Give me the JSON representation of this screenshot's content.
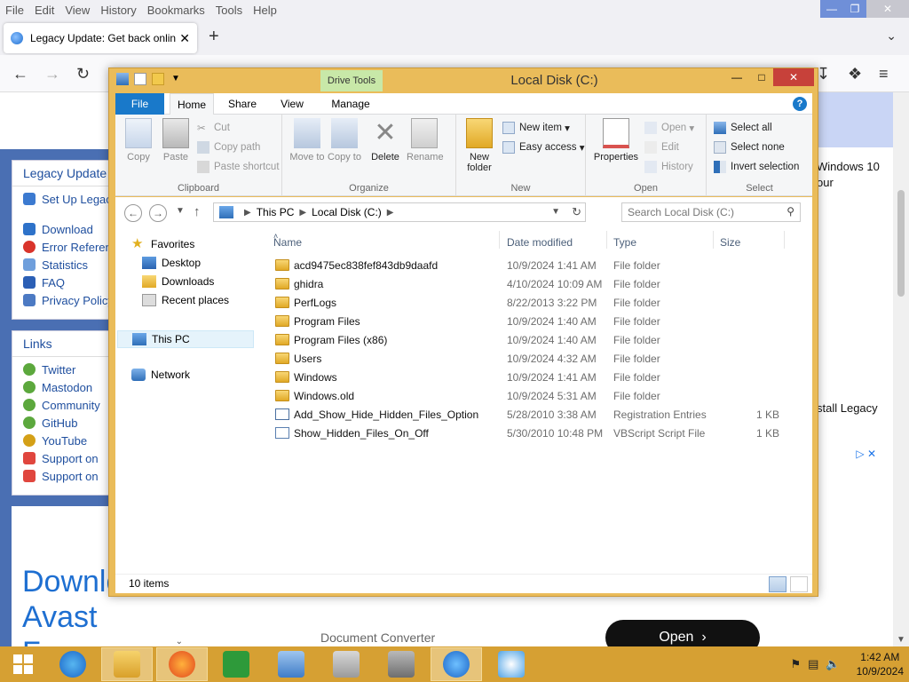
{
  "firefox": {
    "menu": [
      "File",
      "Edit",
      "View",
      "History",
      "Bookmarks",
      "Tools",
      "Help"
    ],
    "tab_title": "Legacy Update: Get back online",
    "sidebar_heading": "Legacy Update",
    "sidebar_items": [
      "Set Up Legacy Update",
      "Download",
      "Error Reference",
      "Statistics",
      "FAQ",
      "Privacy Policy"
    ],
    "links_heading": "Links",
    "links_items": [
      "Twitter",
      "Mastodon",
      "Community",
      "GitHub",
      "YouTube",
      "Support on",
      "Support on"
    ],
    "promo_line1": "Download",
    "promo_line2": "Avast",
    "promo_line3": "F",
    "main_text_1": "Windows 10",
    "main_text_2": "our",
    "main_text_3": "stall Legacy",
    "ad_doc_converter": "Document Converter",
    "ad_open_label": "Open"
  },
  "explorer": {
    "title": "Local Disk (C:)",
    "drive_tools_label": "Drive Tools",
    "tabs": {
      "file": "File",
      "home": "Home",
      "share": "Share",
      "view": "View",
      "manage": "Manage"
    },
    "ribbon": {
      "clipboard": {
        "label": "Clipboard",
        "copy": "Copy",
        "paste": "Paste",
        "cut": "Cut",
        "copy_path": "Copy path",
        "paste_shortcut": "Paste shortcut"
      },
      "organize": {
        "label": "Organize",
        "move_to": "Move to",
        "copy_to": "Copy to",
        "delete": "Delete",
        "rename": "Rename"
      },
      "new": {
        "label": "New",
        "new_folder": "New folder",
        "new_item": "New item",
        "easy_access": "Easy access"
      },
      "open": {
        "label": "Open",
        "properties": "Properties",
        "open": "Open",
        "edit": "Edit",
        "history": "History"
      },
      "select": {
        "label": "Select",
        "select_all": "Select all",
        "select_none": "Select none",
        "invert_selection": "Invert selection"
      }
    },
    "address": {
      "crumbs": [
        "This PC",
        "Local Disk (C:)"
      ],
      "search_placeholder": "Search Local Disk (C:)"
    },
    "nav_pane": {
      "favorites": "Favorites",
      "desktop": "Desktop",
      "downloads": "Downloads",
      "recent_places": "Recent places",
      "this_pc": "This PC",
      "network": "Network"
    },
    "columns": {
      "name": "Name",
      "date_modified": "Date modified",
      "type": "Type",
      "size": "Size"
    },
    "files": [
      {
        "name": "acd9475ec838fef843db9daafd",
        "date": "10/9/2024 1:41 AM",
        "type": "File folder",
        "size": "",
        "kind": "folder"
      },
      {
        "name": "ghidra",
        "date": "4/10/2024 10:09 AM",
        "type": "File folder",
        "size": "",
        "kind": "folder"
      },
      {
        "name": "PerfLogs",
        "date": "8/22/2013 3:22 PM",
        "type": "File folder",
        "size": "",
        "kind": "folder"
      },
      {
        "name": "Program Files",
        "date": "10/9/2024 1:40 AM",
        "type": "File folder",
        "size": "",
        "kind": "folder"
      },
      {
        "name": "Program Files (x86)",
        "date": "10/9/2024 1:40 AM",
        "type": "File folder",
        "size": "",
        "kind": "folder"
      },
      {
        "name": "Users",
        "date": "10/9/2024 4:32 AM",
        "type": "File folder",
        "size": "",
        "kind": "folder"
      },
      {
        "name": "Windows",
        "date": "10/9/2024 1:41 AM",
        "type": "File folder",
        "size": "",
        "kind": "folder"
      },
      {
        "name": "Windows.old",
        "date": "10/9/2024 5:31 AM",
        "type": "File folder",
        "size": "",
        "kind": "folder"
      },
      {
        "name": "Add_Show_Hide_Hidden_Files_Option",
        "date": "5/28/2010 3:38 AM",
        "type": "Registration Entries",
        "size": "1 KB",
        "kind": "reg"
      },
      {
        "name": "Show_Hidden_Files_On_Off",
        "date": "5/30/2010 10:48 PM",
        "type": "VBScript Script File",
        "size": "1 KB",
        "kind": "vbs"
      }
    ],
    "status": "10 items"
  },
  "taskbar": {
    "time": "1:42 AM",
    "date": "10/9/2024"
  },
  "colors": {
    "window_frame": "#eabc5a",
    "taskbar": "#d6a033",
    "accent_blue": "#1979ca",
    "close_red": "#c7413a"
  }
}
